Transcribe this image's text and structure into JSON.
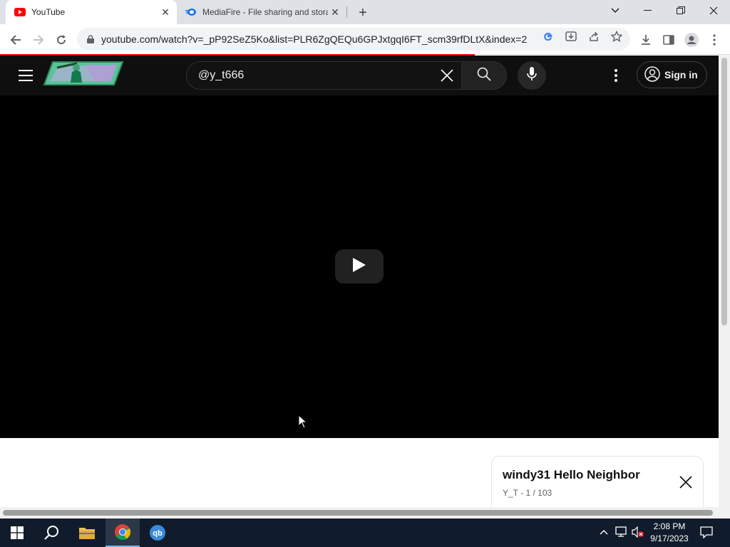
{
  "browser": {
    "tabs": [
      {
        "title": "YouTube",
        "favicon": "youtube-icon",
        "active": true
      },
      {
        "title": "MediaFire - File sharing and storage",
        "favicon": "mediafire-icon",
        "active": false
      }
    ],
    "url": "youtube.com/watch?v=_pP92SeZ5Ko&list=PLR6ZgQEQu6GPJxtgqI6FT_scm39rfDLtX&index=2",
    "accent": "#1a73e8"
  },
  "youtube": {
    "search_query": "@y_t666",
    "sign_in_label": "Sign in",
    "player_state": "paused",
    "progress_fraction": 0.65,
    "playlist": {
      "title": "windy31 Hello Neighbor",
      "owner": "Y_T",
      "separator": " - ",
      "position": "1 / 103"
    },
    "colors": {
      "header_bg": "#0f0f0f",
      "progress": "#ff0000"
    }
  },
  "taskbar": {
    "time": "2:08 PM",
    "date": "9/17/2023",
    "pinned": [
      "start-icon",
      "search-icon",
      "file-explorer-icon",
      "chrome-icon",
      "qbittorrent-icon"
    ]
  }
}
